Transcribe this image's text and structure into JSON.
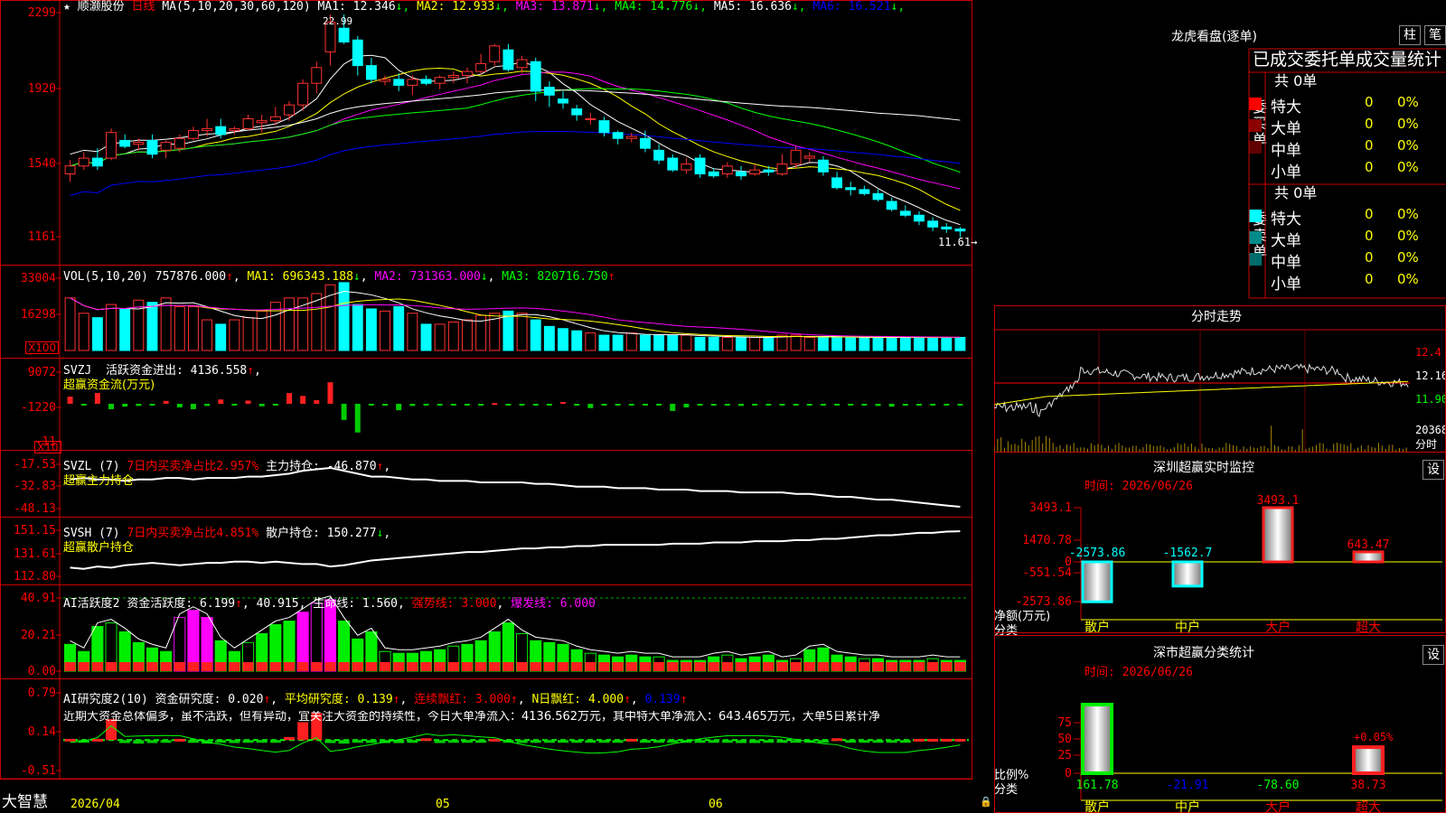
{
  "stock": {
    "star": "★",
    "name": "顺灏股份",
    "period": "日线"
  },
  "price_panel": {
    "ma_params": "MA(5,10,20,30,60,120)",
    "ma_items": [
      {
        "label": "MA1: 12.346",
        "arrow": "↓",
        "color": "#ffffff"
      },
      {
        "label": "MA2: 12.933",
        "arrow": "↓",
        "color": "#ffff00"
      },
      {
        "label": "MA3: 13.871",
        "arrow": "↓",
        "color": "#ff00ff"
      },
      {
        "label": "MA4: 14.776",
        "arrow": "↓",
        "color": "#00ff00"
      },
      {
        "label": "MA5: 16.636",
        "arrow": "↓",
        "color": "#ffffff"
      },
      {
        "label": "MA6: 16.521",
        "arrow": "↓",
        "color": "#0000ff"
      }
    ],
    "y_ticks": [
      "2299",
      "1920",
      "1540",
      "1161"
    ],
    "high_marker": "22.99",
    "low_marker": "11.61→"
  },
  "volume_panel": {
    "title": "VOL(5,10,20)",
    "value": "757876.000",
    "ma1": "MA1: 696343.188",
    "ma2": "MA2: 731363.000",
    "ma3": "MA3: 820716.750",
    "y_ticks": [
      "33004",
      "16298"
    ],
    "unit": "X100"
  },
  "svzj_panel": {
    "title": "SVZJ",
    "line1": "活跃资金进出: 4136.558",
    "line2": "超赢资金流(万元)",
    "y_ticks": [
      "9072",
      "-1220",
      "-11"
    ],
    "unit": "X10"
  },
  "svzl_panel": {
    "title": "SVZL (7)",
    "ratio": "7日内买卖净占比2.957%",
    "hold": "主力持仓: -46.870",
    "line2": "超赢主力持仓",
    "y_ticks": [
      "-17.53",
      "-32.83",
      "-48.13"
    ]
  },
  "svsh_panel": {
    "title": "SVSH (7)",
    "ratio": "7日内买卖净占比4.851%",
    "hold": "散户持仓: 150.277",
    "line2": "超赢散户持仓",
    "y_ticks": [
      "151.15",
      "131.61",
      "112.80"
    ]
  },
  "ai_active_panel": {
    "title": "AI活跃度2",
    "v1": "资金活跃度: 6.199",
    "v2": "40.915",
    "v3": "生命线: 1.560",
    "v4": "强势线: 3.000",
    "v5": "爆发线: 6.000",
    "y_ticks": [
      "40.91",
      "20.21",
      "0.00"
    ]
  },
  "ai_research_panel": {
    "title": "AI研究度2(10)",
    "v1": "资金研究度: 0.020",
    "v2": "平均研究度: 0.139",
    "v3": "连续飘红: 3.000",
    "v4": "N日飘红: 4.000",
    "v5": "0.139",
    "comment": "近期大资金总体偏多，虽不活跃，但有异动，宜关注大资金的持续性，今日大单净流入：4136.562万元，其中特大单净流入：643.465万元，大单5日累计净",
    "y_ticks": [
      "0.79",
      "0.14",
      "-0.51"
    ]
  },
  "footer": {
    "brand": "大智慧",
    "dates": [
      "2026/04",
      "05",
      "06"
    ]
  },
  "dragon_tiger": {
    "title": "龙虎看盘(逐单)",
    "btn1": "柱",
    "btn2": "笔",
    "header": "已成交委托单成交量统计",
    "buy_total": "共 0单",
    "sell_total": "共 0单",
    "buy_label": "委买单",
    "sell_label": "委卖单",
    "buy_rows": [
      {
        "label": "特大",
        "count": "0",
        "pct": "0%",
        "color": "#ff0000"
      },
      {
        "label": "大单",
        "count": "0",
        "pct": "0%",
        "color": "#8b0000"
      },
      {
        "label": "中单",
        "count": "0",
        "pct": "0%",
        "color": "#600000"
      },
      {
        "label": "小单",
        "count": "0",
        "pct": "0%",
        "color": "#000000"
      }
    ],
    "sell_rows": [
      {
        "label": "特大",
        "count": "0",
        "pct": "0%",
        "color": "#00ffff"
      },
      {
        "label": "大单",
        "count": "0",
        "pct": "0%",
        "color": "#008b8b"
      },
      {
        "label": "中单",
        "count": "0",
        "pct": "0%",
        "color": "#006b6b"
      },
      {
        "label": "小单",
        "count": "0",
        "pct": "0%",
        "color": "#000000"
      }
    ]
  },
  "intraday": {
    "title": "分时走势",
    "y_ticks": [
      "12.4",
      "12.16",
      "11.90",
      "20368",
      "分时"
    ]
  },
  "realtime_monitor": {
    "title": "深圳超赢实时监控",
    "btn": "设",
    "time": "时间: 2026/06/26",
    "y_ticks": [
      "3493.1",
      "1470.78",
      "0",
      "-551.54",
      "-2573.86"
    ],
    "ylabel1": "净额(万元)",
    "ylabel2": "分类",
    "categories": [
      "散户",
      "中户",
      "大户",
      "超大"
    ],
    "value_labels": [
      "-2573.86",
      "-1562.7",
      "3493.1",
      "643.47"
    ]
  },
  "class_stats": {
    "title": "深市超赢分类统计",
    "btn": "设",
    "time": "时间: 2026/06/26",
    "y_ticks": [
      "75",
      "50",
      "25",
      "0"
    ],
    "ylabel1": "比例%",
    "ylabel2": "分类",
    "categories": [
      "散户",
      "中户",
      "大户",
      "超大"
    ],
    "bottom_values": [
      "161.78",
      "-21.91",
      "-78.60",
      "38.73"
    ],
    "top_label": "+0.05%"
  },
  "chart_data": [
    {
      "type": "candlestick",
      "name": "日线",
      "ylim": [
        11.61,
        22.99
      ],
      "ohlc": [
        [
          14.8,
          15.5,
          14.4,
          15.2
        ],
        [
          15.2,
          15.9,
          15.0,
          15.6
        ],
        [
          15.6,
          16.1,
          15.0,
          15.2
        ],
        [
          15.6,
          17.1,
          15.5,
          16.9
        ],
        [
          16.5,
          16.8,
          16.1,
          16.2
        ],
        [
          16.3,
          16.6,
          16.0,
          16.4
        ],
        [
          16.5,
          16.8,
          15.6,
          15.8
        ],
        [
          16.0,
          16.5,
          15.6,
          16.4
        ],
        [
          16.1,
          16.8,
          15.9,
          16.6
        ],
        [
          16.6,
          17.2,
          16.5,
          17.0
        ],
        [
          17.0,
          17.6,
          16.7,
          17.1
        ],
        [
          17.2,
          17.6,
          16.6,
          16.8
        ],
        [
          17.0,
          17.2,
          16.8,
          17.1
        ],
        [
          17.1,
          17.8,
          17.0,
          17.6
        ],
        [
          17.4,
          17.8,
          16.9,
          17.5
        ],
        [
          17.5,
          18.2,
          17.3,
          17.7
        ],
        [
          17.8,
          18.5,
          17.5,
          18.3
        ],
        [
          18.3,
          19.6,
          18.0,
          19.4
        ],
        [
          19.4,
          20.5,
          18.9,
          20.2
        ],
        [
          21.0,
          22.9,
          20.3,
          22.5
        ],
        [
          22.2,
          22.9,
          21.4,
          21.5
        ],
        [
          21.6,
          21.8,
          19.8,
          20.3
        ],
        [
          20.3,
          20.7,
          19.4,
          19.6
        ],
        [
          19.5,
          19.8,
          19.3,
          19.6
        ],
        [
          19.6,
          19.9,
          19.0,
          19.3
        ],
        [
          19.3,
          19.8,
          18.8,
          19.6
        ],
        [
          19.6,
          19.8,
          19.3,
          19.4
        ],
        [
          19.4,
          19.8,
          19.1,
          19.7
        ],
        [
          19.7,
          20.0,
          19.4,
          19.8
        ],
        [
          19.8,
          20.2,
          19.4,
          20.0
        ],
        [
          20.0,
          20.9,
          19.9,
          20.4
        ],
        [
          20.5,
          21.4,
          20.3,
          21.3
        ],
        [
          21.1,
          21.4,
          20.0,
          20.1
        ],
        [
          20.2,
          20.8,
          19.9,
          20.6
        ],
        [
          20.5,
          20.7,
          18.5,
          19.0
        ],
        [
          19.2,
          19.5,
          18.2,
          18.8
        ],
        [
          18.6,
          19.0,
          18.1,
          18.4
        ],
        [
          18.1,
          18.3,
          17.5,
          17.8
        ],
        [
          17.6,
          17.9,
          17.3,
          17.6
        ],
        [
          17.5,
          17.7,
          16.7,
          16.9
        ],
        [
          16.9,
          17.0,
          16.3,
          16.6
        ],
        [
          16.6,
          16.9,
          16.4,
          16.7
        ],
        [
          16.6,
          17.0,
          15.9,
          16.1
        ],
        [
          16.0,
          16.3,
          15.3,
          15.5
        ],
        [
          15.6,
          15.8,
          14.9,
          15.0
        ],
        [
          15.0,
          15.6,
          14.8,
          15.3
        ],
        [
          15.6,
          15.8,
          14.6,
          14.8
        ],
        [
          14.9,
          15.1,
          14.6,
          14.7
        ],
        [
          14.8,
          15.4,
          14.6,
          15.2
        ],
        [
          14.9,
          15.2,
          14.5,
          14.7
        ],
        [
          14.8,
          15.3,
          14.7,
          15.0
        ],
        [
          15.0,
          15.2,
          14.7,
          14.9
        ],
        [
          14.8,
          15.8,
          14.7,
          15.3
        ],
        [
          15.3,
          16.2,
          15.1,
          16.0
        ],
        [
          15.6,
          15.9,
          15.4,
          15.7
        ],
        [
          15.5,
          15.7,
          14.7,
          14.9
        ],
        [
          14.6,
          14.9,
          14.0,
          14.1
        ],
        [
          14.1,
          14.4,
          13.7,
          14.0
        ],
        [
          14.0,
          14.2,
          13.7,
          13.8
        ],
        [
          13.8,
          14.0,
          13.4,
          13.5
        ],
        [
          13.4,
          13.6,
          12.9,
          13.0
        ],
        [
          12.9,
          13.2,
          12.6,
          12.7
        ],
        [
          12.7,
          12.9,
          12.2,
          12.4
        ],
        [
          12.4,
          12.6,
          11.9,
          12.1
        ],
        [
          12.1,
          12.3,
          11.8,
          12.0
        ],
        [
          12.0,
          12.1,
          11.6,
          11.9
        ]
      ]
    },
    {
      "type": "bar",
      "name": "VOL",
      "unit": "X100",
      "ylim": [
        0,
        33004
      ],
      "values": [
        24000,
        17000,
        15000,
        21000,
        19000,
        23000,
        22000,
        24000,
        20000,
        20000,
        14000,
        12000,
        14000,
        15000,
        18000,
        22000,
        24000,
        24000,
        26000,
        30000,
        31000,
        21000,
        19000,
        18000,
        20000,
        17000,
        12000,
        12000,
        13000,
        14000,
        16000,
        17000,
        18000,
        17000,
        14000,
        11000,
        10000,
        9000,
        8000,
        7000,
        7000,
        8000,
        7000,
        7000,
        7000,
        7000,
        6000,
        6000,
        6000,
        6000,
        6000,
        6000,
        7000,
        7000,
        6000,
        6000,
        6000,
        6000,
        6000,
        6000,
        6000,
        6000,
        6000,
        6000,
        6000,
        6000
      ]
    },
    {
      "type": "bar",
      "name": "SVZJ",
      "values": [
        2000,
        -300,
        3000,
        -1500,
        -800,
        -600,
        -300,
        800,
        -1000,
        -1500,
        -600,
        1200,
        -500,
        900,
        -700,
        -300,
        3000,
        2200,
        1000,
        6000,
        -4500,
        -8000,
        -200,
        -400,
        -1800,
        -600,
        -500,
        -400,
        -300,
        -200,
        -100,
        200,
        -200,
        -300,
        -200,
        -400,
        500,
        -300,
        -1200,
        -400,
        -200,
        -100,
        -300,
        -400,
        -2000,
        -1000,
        -200,
        -100,
        -300,
        -600,
        -200,
        -300,
        -150,
        -200,
        -400,
        -200,
        -100,
        -300,
        -400,
        -600,
        -800,
        -300,
        -200,
        -150,
        -100,
        -100
      ],
      "ylim": [
        -11,
        9072
      ]
    },
    {
      "type": "line",
      "name": "主力持仓",
      "ylim": [
        -48.13,
        -17.53
      ],
      "values": [
        -28,
        -27,
        -28,
        -28,
        -29,
        -28,
        -28,
        -27,
        -27,
        -28,
        -27,
        -27,
        -27,
        -26,
        -26,
        -25,
        -24,
        -22,
        -21,
        -20,
        -22,
        -24,
        -26,
        -26,
        -27,
        -28,
        -28,
        -29,
        -29,
        -29,
        -30,
        -30,
        -30,
        -30,
        -31,
        -31,
        -32,
        -33,
        -33,
        -33,
        -34,
        -34,
        -34,
        -35,
        -35,
        -35,
        -36,
        -36,
        -36,
        -37,
        -37,
        -37,
        -37,
        -38,
        -38,
        -39,
        -40,
        -40,
        -41,
        -42,
        -42,
        -43,
        -44,
        -45,
        -46,
        -46.87
      ]
    },
    {
      "type": "line",
      "name": "散户持仓",
      "ylim": [
        112.8,
        151.15
      ],
      "values": [
        120,
        119,
        121,
        120,
        122,
        123,
        124,
        123,
        122,
        123,
        124,
        124,
        125,
        125,
        124,
        125,
        124,
        123,
        123,
        121,
        122,
        124,
        126,
        127,
        128,
        129,
        130,
        131,
        132,
        133,
        133,
        134,
        135,
        136,
        136,
        137,
        137,
        138,
        138,
        139,
        139,
        139,
        139,
        139,
        140,
        140,
        140,
        141,
        141,
        141,
        142,
        142,
        142,
        143,
        143,
        144,
        144,
        145,
        146,
        147,
        147,
        148,
        149,
        149,
        150,
        150.277
      ]
    },
    {
      "type": "bar",
      "name": "AI活跃度2",
      "ylim": [
        0,
        40.91
      ],
      "values": [
        15,
        11,
        25,
        27,
        22,
        16,
        13,
        11,
        30,
        34,
        30,
        17,
        11,
        16,
        21,
        26,
        28,
        33,
        38,
        40,
        28,
        18,
        22,
        11,
        10,
        10,
        11,
        12,
        14,
        15,
        17,
        22,
        27,
        21,
        17,
        16,
        15,
        12,
        10,
        9,
        8,
        9,
        8,
        8,
        6,
        6,
        6,
        8,
        9,
        7,
        8,
        9,
        6,
        7,
        12,
        13,
        9,
        8,
        7,
        7,
        6,
        6,
        6,
        7,
        6,
        6
      ]
    },
    {
      "type": "bar",
      "name": "AI研究度2",
      "ylim": [
        -0.51,
        0.79
      ],
      "values": [
        0.02,
        -0.02,
        0.02,
        0.35,
        -0.05,
        -0.06,
        -0.05,
        -0.02,
        0.02,
        -0.02,
        -0.06,
        -0.04,
        -0.05,
        -0.02,
        -0.02,
        -0.03,
        0.05,
        0.3,
        0.45,
        -0.05,
        -0.06,
        -0.04,
        -0.05,
        -0.05,
        -0.05,
        -0.03,
        0.03,
        -0.05,
        -0.02,
        -0.03,
        -0.02,
        0.02,
        -0.03,
        -0.05,
        -0.04,
        -0.04,
        -0.03,
        -0.03,
        -0.04,
        -0.03,
        -0.02,
        0.02,
        -0.02,
        -0.04,
        -0.03,
        -0.03,
        -0.02,
        -0.03,
        -0.03,
        -0.05,
        -0.05,
        -0.04,
        -0.03,
        -0.04,
        -0.03,
        -0.02,
        0.03,
        -0.02,
        -0.04,
        -0.04,
        -0.02,
        -0.02,
        0.02,
        0.02,
        0.02,
        0.02
      ]
    },
    {
      "type": "bar",
      "name": "深圳超赢实时监控",
      "categories": [
        "散户",
        "中户",
        "大户",
        "超大"
      ],
      "values": [
        -2573.86,
        -1562.7,
        3493.1,
        643.47
      ],
      "ylim": [
        -2573.86,
        3493.1
      ]
    },
    {
      "type": "bar",
      "name": "深市超赢分类统计",
      "categories": [
        "散户",
        "中户",
        "大户",
        "超大"
      ],
      "values": [
        100,
        0,
        0,
        38
      ],
      "ylim": [
        0,
        100
      ]
    }
  ]
}
